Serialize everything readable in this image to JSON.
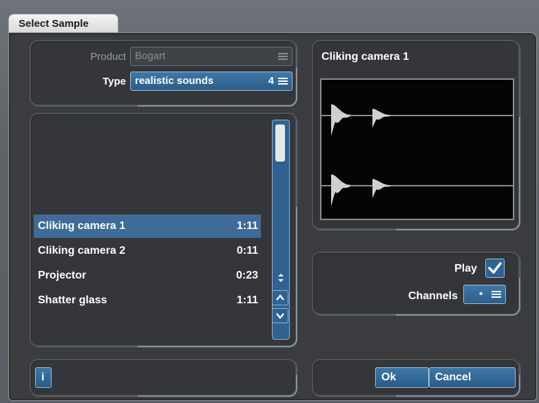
{
  "window": {
    "title": "Select Sample"
  },
  "filters": {
    "product_label": "Product",
    "product_value": "Bogart",
    "type_label": "Type",
    "type_value": "realistic sounds",
    "type_count": "4"
  },
  "samples": [
    {
      "name": "Cliking camera 1",
      "duration": "1:11",
      "selected": true
    },
    {
      "name": "Cliking camera 2",
      "duration": "0:11",
      "selected": false
    },
    {
      "name": "Projector",
      "duration": "0:23",
      "selected": false
    },
    {
      "name": "Shatter glass",
      "duration": "1:11",
      "selected": false
    }
  ],
  "preview": {
    "title": "Cliking camera 1"
  },
  "options": {
    "play_label": "Play",
    "play_checked": true,
    "channels_label": "Channels",
    "channels_value": "•"
  },
  "buttons": {
    "info": "i",
    "ok": "Ok",
    "cancel": "Cancel"
  },
  "colors": {
    "accent": "#2f6290",
    "selection": "#3e6b98",
    "panel": "#34363a",
    "waveform_bg": "#050505",
    "waveform": "#d8d8d8"
  }
}
